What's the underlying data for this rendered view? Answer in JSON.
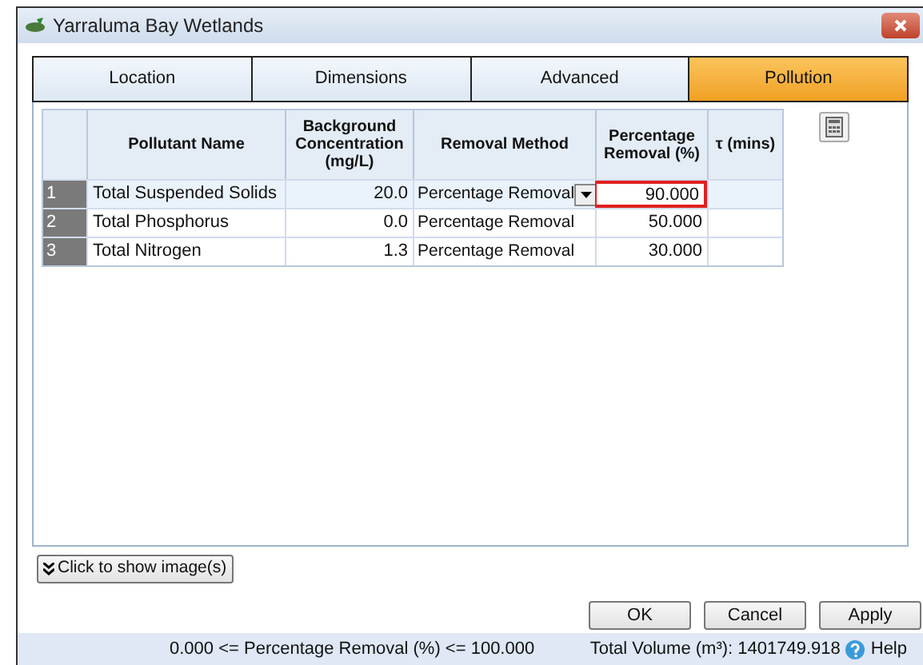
{
  "window": {
    "title": "Yarraluma Bay Wetlands"
  },
  "tabs": [
    {
      "label": "Location",
      "selected": false
    },
    {
      "label": "Dimensions",
      "selected": false
    },
    {
      "label": "Advanced",
      "selected": false
    },
    {
      "label": "Pollution",
      "selected": true
    }
  ],
  "table": {
    "columns": [
      "",
      "Pollutant Name",
      "Background Concentration (mg/L)",
      "Removal Method",
      "Percentage Removal (%)",
      "τ (mins)"
    ],
    "rows": [
      {
        "number": "1",
        "name": "Total Suspended Solids",
        "background": "20.0",
        "method": "Percentage Removal",
        "removal": "90.000",
        "tau": "",
        "selected": true
      },
      {
        "number": "2",
        "name": "Total Phosphorus",
        "background": "0.0",
        "method": "Percentage Removal",
        "removal": "50.000",
        "tau": "",
        "selected": false
      },
      {
        "number": "3",
        "name": "Total Nitrogen",
        "background": "1.3",
        "method": "Percentage Removal",
        "removal": "30.000",
        "tau": "",
        "selected": false
      }
    ]
  },
  "show_images_button": "Click to show image(s)",
  "buttons": [
    "OK",
    "Cancel",
    "Apply"
  ],
  "status_bar": {
    "hint": "0.000 <= Percentage Removal (%) <= 100.000",
    "volume": "Total Volume (m³): 1401749.918",
    "help": "Help"
  }
}
